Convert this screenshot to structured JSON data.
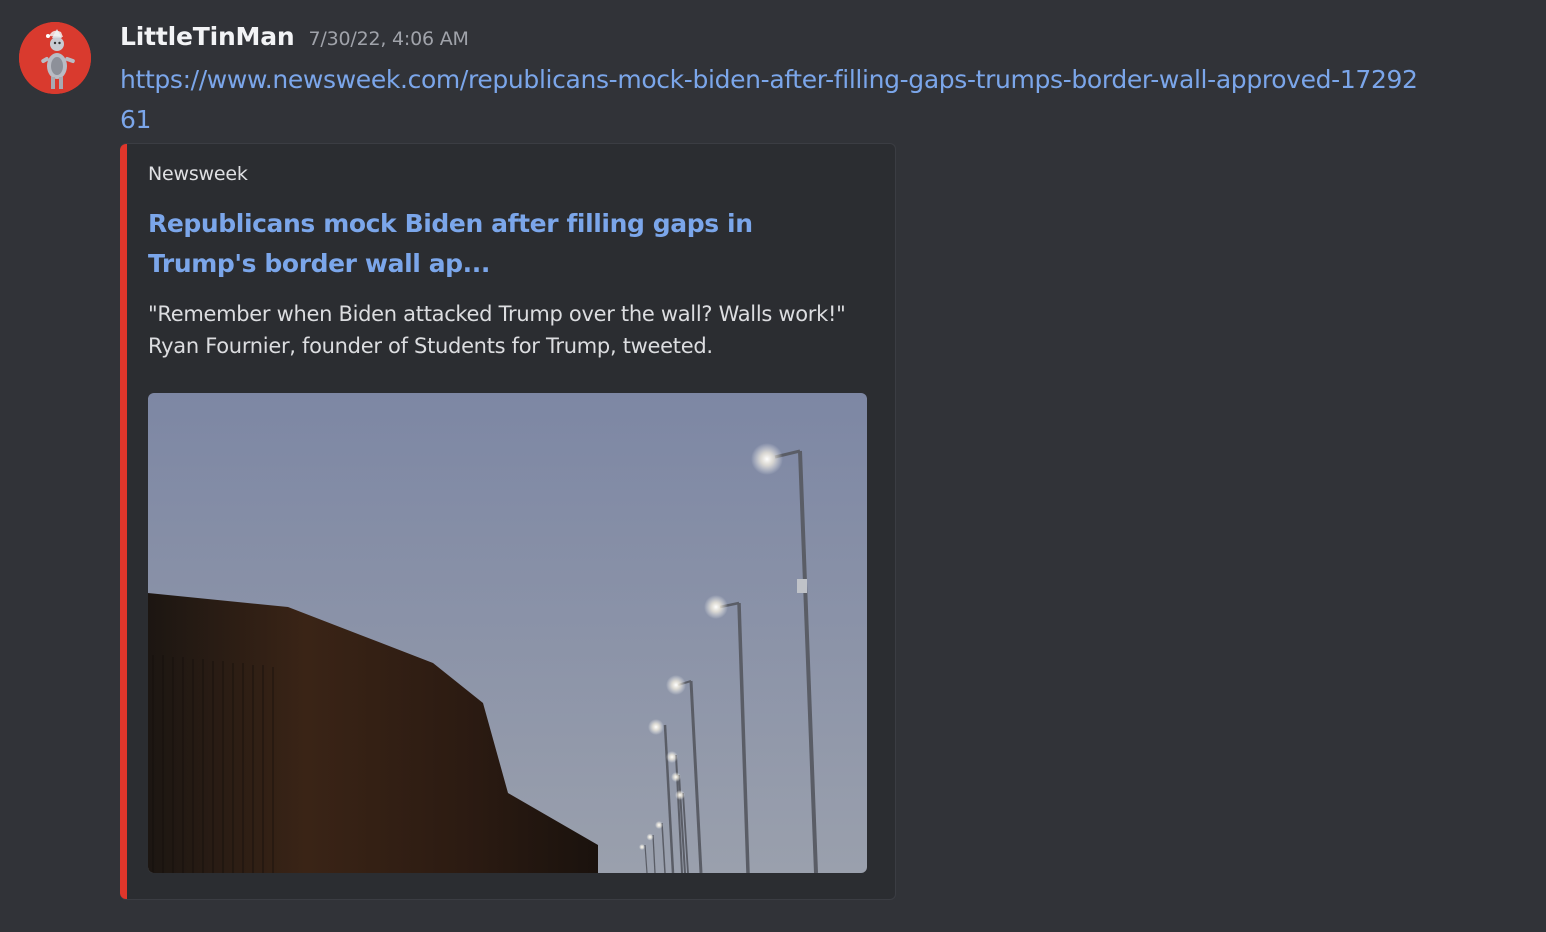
{
  "message": {
    "author": "LittleTinMan",
    "timestamp": "7/30/22, 4:06 AM",
    "link": "https://www.newsweek.com/republicans-mock-biden-after-filling-gaps-trumps-border-wall-approved-1729261",
    "avatar_icon": "tin-man-avatar"
  },
  "embed": {
    "provider": "Newsweek",
    "title": "Republicans mock Biden after filling gaps in Trump's border wall ap...",
    "description": "\"Remember when Biden attacked Trump over the wall? Walls work!\" Ryan Fournier, founder of Students for Trump, tweeted.",
    "accent_color": "#e0362b",
    "image": "border-wall-at-dusk-with-street-lights"
  },
  "colors": {
    "background": "#313338",
    "embed_background": "#2b2d31",
    "link": "#7ba6ea",
    "username": "#f2f3f5",
    "timestamp": "#a0a3aa"
  }
}
